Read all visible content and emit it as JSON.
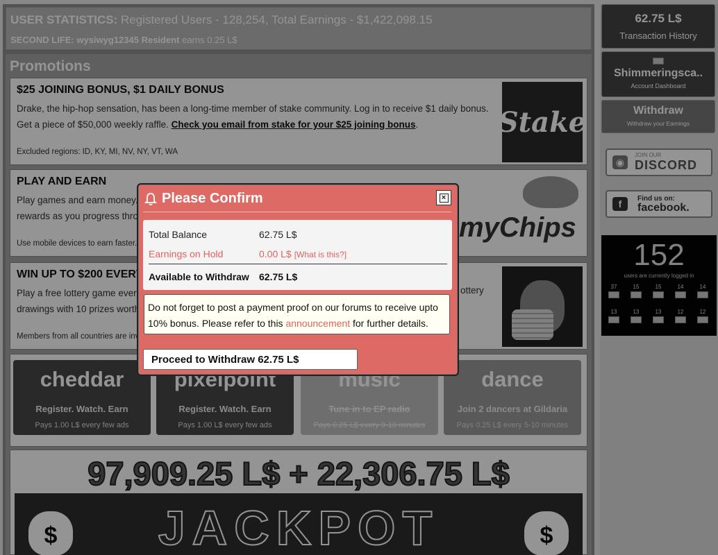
{
  "stats": {
    "label": "USER STATISTICS:",
    "summary": "Registered Users - 128,254, Total Earnings - $1,422,098.15",
    "sl_label": "SECOND LIFE:",
    "sl_user": "wysiwyg12345 Resident",
    "sl_earns": "earns 0.25 L$"
  },
  "promotions": {
    "title": "Promotions",
    "cards": [
      {
        "title": "$25 JOINING BONUS, $1 DAILY BONUS",
        "desc": "Drake, the hip-hop sensation, has been a long-time member of stake community. Log in to receive $1 daily bonus. Get a piece of $50,000 weekly raffle.",
        "link": "Check you email from stake for your $25 joining bonus",
        "extra": "Excluded regions: ID, KY, MI, NV, NY, VT, WA",
        "logo": "Stake"
      },
      {
        "title": "PLAY AND EARN",
        "desc": "Play games and earn money. rewards as you progress thro",
        "extra": "Use mobile devices to earn faster. U",
        "logo": "myChips"
      },
      {
        "title": "WIN UP TO $200 EVERY HO",
        "desc": "Play a free lottery game ever drawings with 10 prizes worth",
        "desc_right": "ottery",
        "extra": "Members from all countries are invi",
        "logo": "money-bag-icon"
      }
    ],
    "tiles": [
      {
        "name": "cheddar",
        "sub": "Register. Watch. Earn",
        "pay": "Pays 1.00 L$ every few ads"
      },
      {
        "name": "pixelpoint",
        "sub": "Register. Watch. Earn",
        "pay": "Pays 1.00 L$ every few ads"
      },
      {
        "name": "music",
        "sub": "Tune in to EP radio",
        "pay": "Pays 0.25 L$ every 9-10 minutes"
      },
      {
        "name": "dance",
        "sub": "Join 2 dancers at Gildaria",
        "pay": "Pays 0.25 L$ every 5-10 minutes"
      }
    ],
    "jackpot": {
      "total": "97,909.25 L$ + 22,306.75 L$",
      "word": "JACKPOT"
    }
  },
  "sidebar": {
    "balance": "62.75 L$",
    "history": "Transaction History",
    "account_name": "Shimmeringsca..",
    "account_sub": "Account Dashboard",
    "withdraw": "Withdraw",
    "withdraw_sub": "Withdraw your Earnings",
    "discord_small": "JOIN OUR",
    "discord": "DISCORD",
    "facebook_small": "Find us on:",
    "facebook": "facebook.",
    "online_count": "152",
    "online_label": "users are currently logged in",
    "flags_row1": [
      "37",
      "15",
      "15",
      "14",
      "14"
    ],
    "flags_row2": [
      "13",
      "13",
      "13",
      "12",
      "12"
    ]
  },
  "modal": {
    "title": "Please Confirm",
    "total_label": "Total Balance",
    "total_value": "62.75 L$",
    "hold_label": "Earnings on Hold",
    "hold_value": "0.00 L$",
    "hold_help": "[What is this?]",
    "avail_label": "Available to Withdraw",
    "avail_value": "62.75 L$",
    "note_pre": "Do not forget to post a payment proof on our forums to receive upto 10% bonus. Please refer to this",
    "note_link": "announcement",
    "note_post": "for further details.",
    "proceed": "Proceed to Withdraw 62.75 L$"
  },
  "colors": {
    "modal_bg": "#de6a66",
    "accent_link": "#e0625e"
  }
}
